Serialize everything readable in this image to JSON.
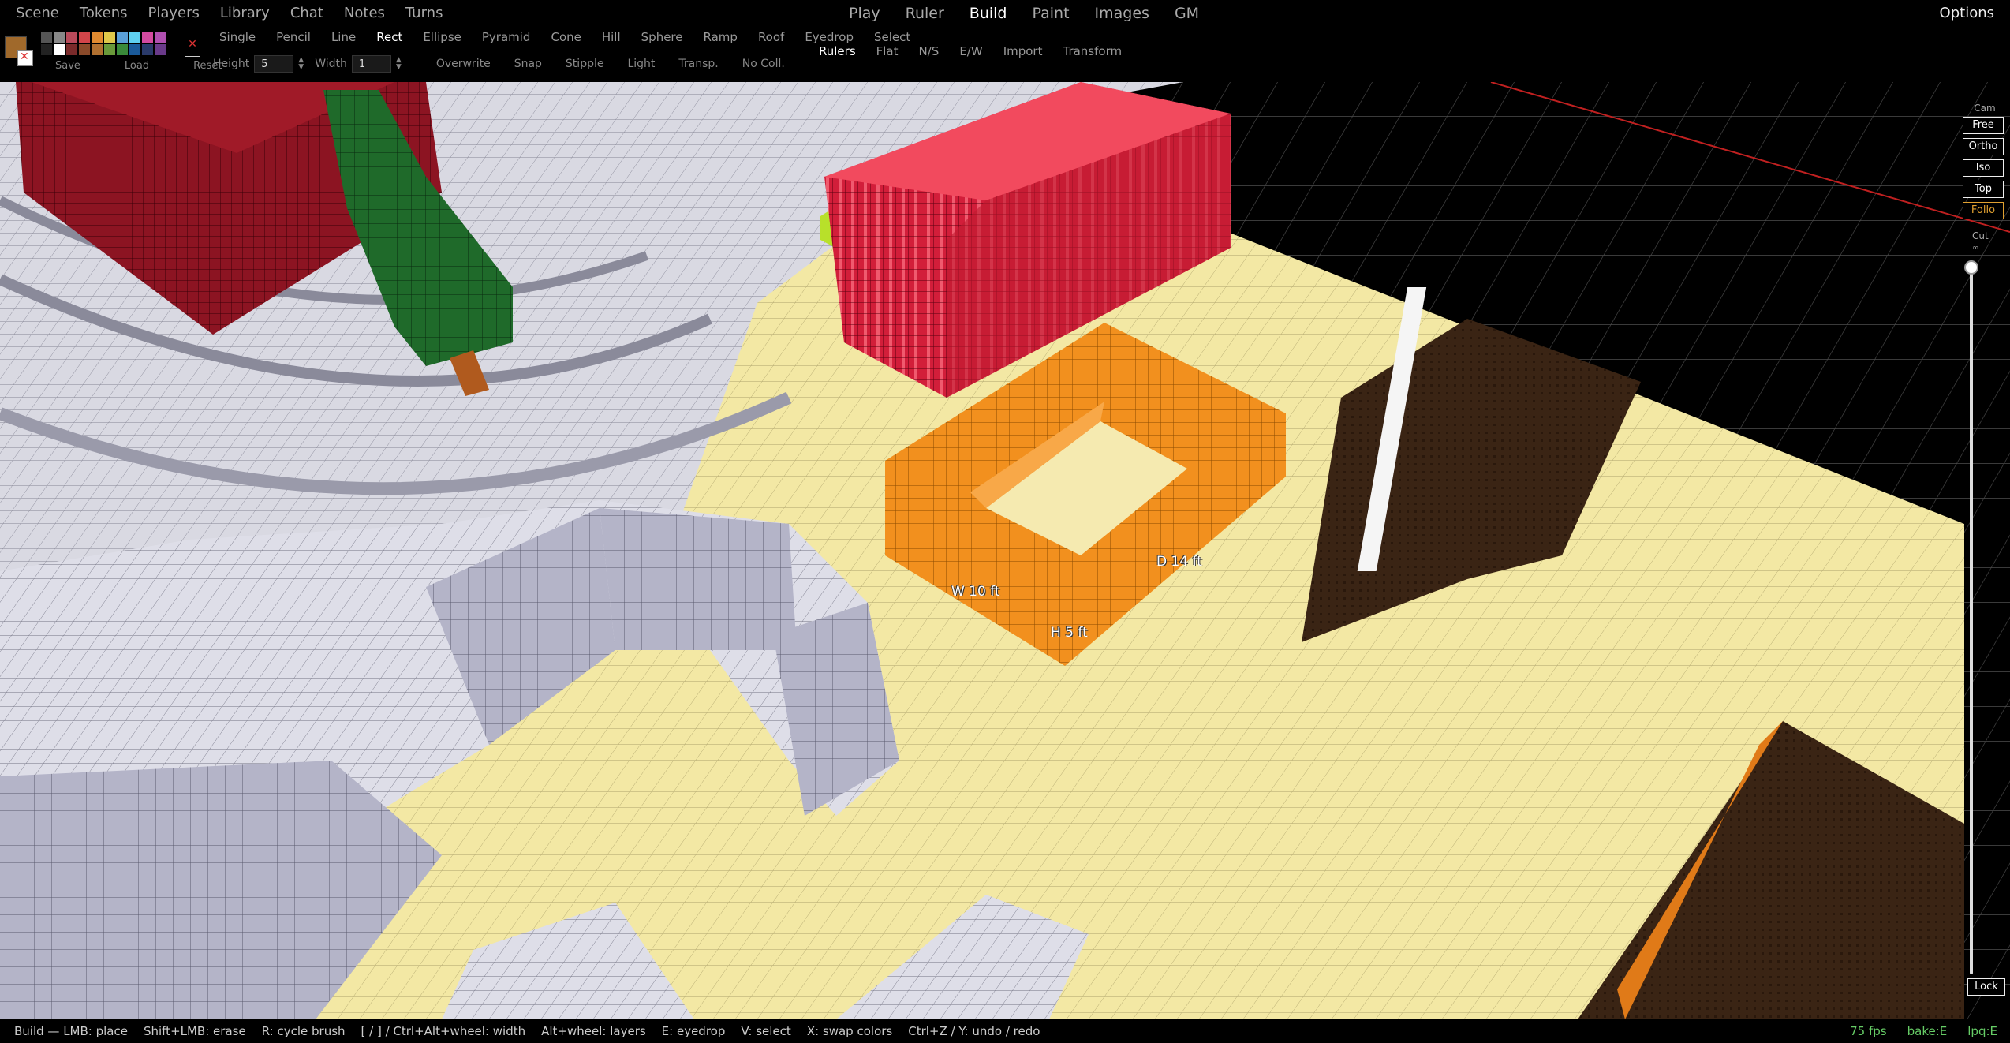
{
  "menu": {
    "left": [
      "Scene",
      "Tokens",
      "Players",
      "Library",
      "Chat",
      "Notes",
      "Turns"
    ],
    "modes": [
      "Play",
      "Ruler",
      "Build",
      "Paint",
      "Images",
      "GM"
    ],
    "active_mode": "Build",
    "options": "Options"
  },
  "palette": {
    "primary_color": "#a0692b",
    "colors": [
      "#555555",
      "#888888",
      "#b94a5a",
      "#d2454a",
      "#e08a30",
      "#e0c84a",
      "#5aa0d8",
      "#5fd0f0",
      "#d44aa0",
      "#b050b0",
      "#222222",
      "#ffffff",
      "#7a2a2a",
      "#8a4a2a",
      "#b07030",
      "#6a9a3a",
      "#3a8a3a",
      "#1a5a9a",
      "#2a3a6a",
      "#6a3a8a"
    ],
    "actions": [
      "Save",
      "Load",
      "Reset"
    ]
  },
  "tools": {
    "shapes": [
      "Single",
      "Pencil",
      "Line",
      "Rect",
      "Ellipse",
      "Pyramid",
      "Cone",
      "Hill",
      "Sphere",
      "Ramp",
      "Roof",
      "Eyedrop",
      "Select"
    ],
    "active_shape": "Rect",
    "height_label": "Height",
    "height_value": "5",
    "width_label": "Width",
    "width_value": "1",
    "options": [
      "Overwrite",
      "Snap",
      "Stipple",
      "Light",
      "Transp.",
      "No Coll."
    ]
  },
  "rulers": {
    "label": "Rulers",
    "items": [
      "Flat",
      "N/S",
      "E/W",
      "Import",
      "Transform"
    ]
  },
  "camera": {
    "label": "Cam",
    "modes": [
      "Free",
      "Ortho",
      "Iso",
      "Top",
      "Follo"
    ],
    "cut_label": "Cut",
    "cut_value": "∞",
    "lock": "Lock"
  },
  "measurements": {
    "width": "W 10 ft",
    "depth": "D 14 ft",
    "height": "H 5 ft"
  },
  "status": {
    "hints": [
      "Build — LMB: place",
      "Shift+LMB: erase",
      "R: cycle brush",
      "[ / ] / Ctrl+Alt+wheel: width",
      "Alt+wheel: layers",
      "E: eyedrop",
      "V: select",
      "X: swap colors",
      "Ctrl+Z / Y: undo / redo"
    ],
    "fps": "75 fps",
    "bake": "bake:E",
    "lpq": "lpq:E"
  }
}
